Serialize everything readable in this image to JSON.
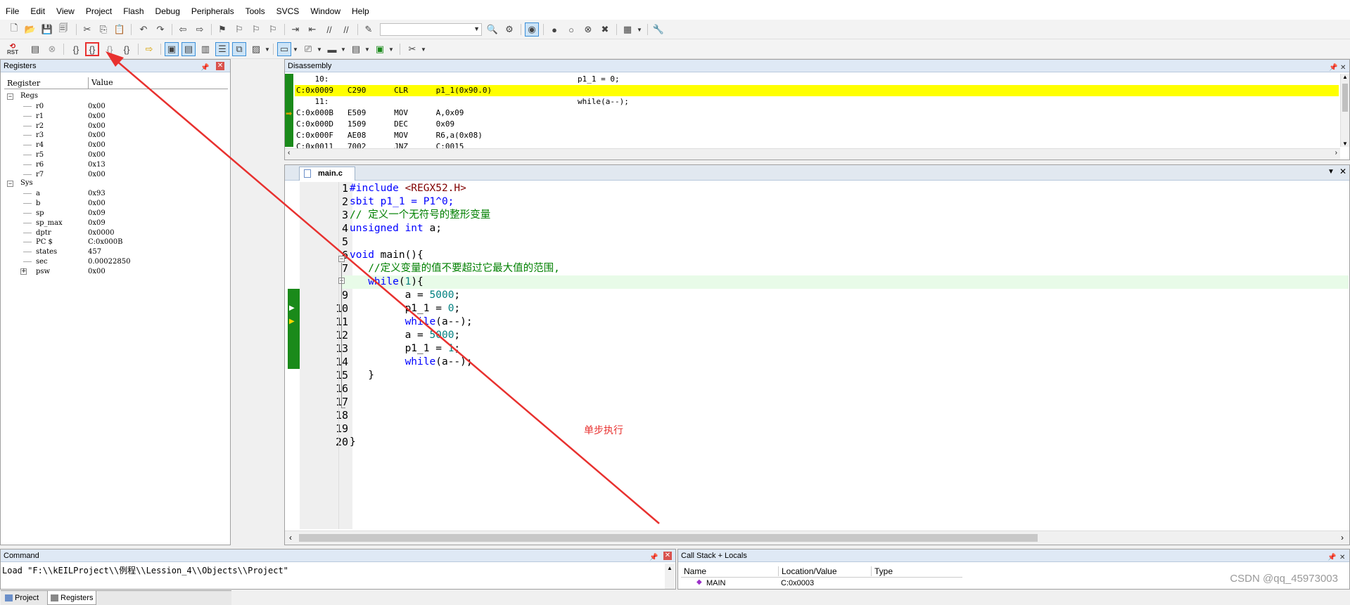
{
  "menu": [
    "File",
    "Edit",
    "View",
    "Project",
    "Flash",
    "Debug",
    "Peripherals",
    "Tools",
    "SVCS",
    "Window",
    "Help"
  ],
  "toolbar2": {
    "rst_label": "RST"
  },
  "registers": {
    "title": "Registers",
    "col_register": "Register",
    "col_value": "Value",
    "groups": [
      {
        "name": "Regs",
        "expanded": true,
        "items": [
          {
            "name": "r0",
            "value": "0x00"
          },
          {
            "name": "r1",
            "value": "0x00"
          },
          {
            "name": "r2",
            "value": "0x00"
          },
          {
            "name": "r3",
            "value": "0x00"
          },
          {
            "name": "r4",
            "value": "0x00"
          },
          {
            "name": "r5",
            "value": "0x00"
          },
          {
            "name": "r6",
            "value": "0x13"
          },
          {
            "name": "r7",
            "value": "0x00"
          }
        ]
      },
      {
        "name": "Sys",
        "expanded": true,
        "items": [
          {
            "name": "a",
            "value": "0x93"
          },
          {
            "name": "b",
            "value": "0x00"
          },
          {
            "name": "sp",
            "value": "0x09"
          },
          {
            "name": "sp_max",
            "value": "0x09"
          },
          {
            "name": "dptr",
            "value": "0x0000"
          },
          {
            "name": "PC  $",
            "value": "C:0x000B"
          },
          {
            "name": "states",
            "value": "457"
          },
          {
            "name": "sec",
            "value": "0.00022850"
          },
          {
            "name": "psw",
            "value": "0x00"
          }
        ]
      }
    ],
    "tabs": [
      "Project",
      "Registers"
    ]
  },
  "disassembly": {
    "title": "Disassembly",
    "lines": [
      {
        "addr": "    10:",
        "code": "",
        "src": "p1_1 = 0;"
      },
      {
        "addr": "C:0x0009",
        "code": "   C290      CLR      p1_1(0x90.0)",
        "src": ""
      },
      {
        "addr": "    11:",
        "code": "",
        "src": "while(a--);"
      },
      {
        "addr": "C:0x000B",
        "code": "   E509      MOV      A,0x09",
        "src": ""
      },
      {
        "addr": "C:0x000D",
        "code": "   1509      DEC      0x09",
        "src": ""
      },
      {
        "addr": "C:0x000F",
        "code": "   AE08      MOV      R6,a(0x08)",
        "src": ""
      },
      {
        "addr": "C:0x0011",
        "code": "   7002      JNZ      C:0015",
        "src": ""
      }
    ]
  },
  "editor": {
    "tab": "main.c",
    "lines": [
      "1",
      "2",
      "3",
      "4",
      "5",
      "6",
      "7",
      "8",
      "9",
      "10",
      "11",
      "12",
      "13",
      "14",
      "15",
      "16",
      "17",
      "18",
      "19",
      "20"
    ],
    "code": {
      "l1": "#include ",
      "l1b": "<REGX52.H>",
      "l2": "sbit p1_1 = P1^0;",
      "l3": "// 定义一个无符号的整形变量",
      "l4a": "unsigned int",
      "l4b": " a;",
      "l6a": "void",
      "l6b": " main(){",
      "l7": "   //定义变量的值不要超过它最大值的范围,",
      "l8a": "   while",
      "l8b": "(",
      "l8c": "1",
      "l8d": "){",
      "l9a": "         a = ",
      "l9b": "5000",
      "l9c": ";",
      "l10a": "         p1_1 = ",
      "l10b": "0",
      "l10c": ";",
      "l11a": "         while",
      "l11b": "(a--);",
      "l12a": "         a = ",
      "l12b": "5000",
      "l12c": ";",
      "l13a": "         p1_1 = ",
      "l13b": "1",
      "l13c": ";",
      "l14a": "         while",
      "l14b": "(a--);",
      "l15": "   }",
      "l20": "}"
    },
    "annotation": "单步执行"
  },
  "command": {
    "title": "Command",
    "text": "Load \"F:\\\\kEILProject\\\\例程\\\\Lession_4\\\\Objects\\\\Project\""
  },
  "callstack": {
    "title": "Call Stack + Locals",
    "col_name": "Name",
    "col_location": "Location/Value",
    "col_type": "Type",
    "row_name": "MAIN",
    "row_location": "C:0x0003"
  },
  "watermark": "CSDN @qq_45973003",
  "colors": {
    "highlight_line": "#ffff00",
    "current_line": "#e8fbe8",
    "annotation_red": "#e8312f"
  }
}
